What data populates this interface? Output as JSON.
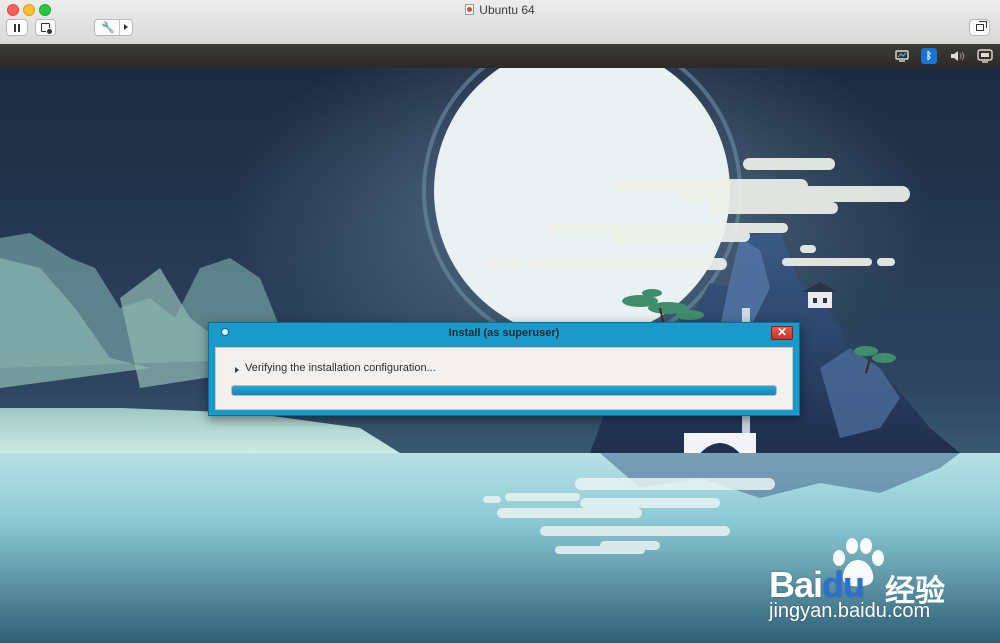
{
  "window": {
    "title": "Ubuntu 64"
  },
  "toolbar": {
    "pause_icon": "pause-icon",
    "snapshot_icon": "snapshot-icon",
    "settings_icon": "wrench-icon",
    "restore_icon": "restore-window-icon"
  },
  "panel": {
    "icons": [
      "display-icon",
      "bluetooth-icon",
      "volume-icon",
      "monitor-icon"
    ],
    "bluetooth_glyph": "ᛒ"
  },
  "dialog": {
    "title": "Install (as superuser)",
    "close_glyph": "✕",
    "status": "Verifying the installation configuration...",
    "progress": 1.0
  },
  "watermark": {
    "brand": "Bai",
    "brand_suffix": "du",
    "cn": "经验",
    "url": "jingyan.baidu.com"
  },
  "colors": {
    "dialog_border": "#1a9ac9",
    "close_red": "#d9412f",
    "progress_blue": "#1593c6",
    "sky": "#1f2f45",
    "water": "#9fd4dc"
  }
}
